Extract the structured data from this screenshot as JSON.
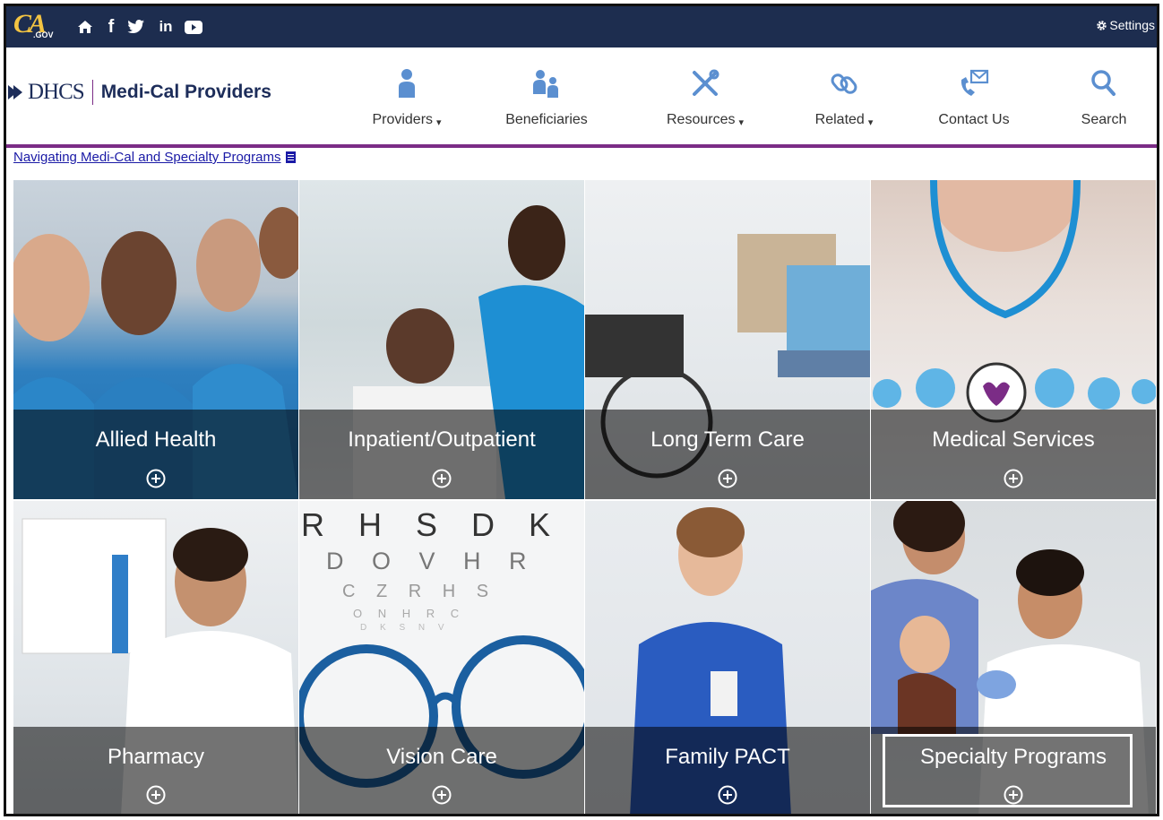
{
  "topbar": {
    "logo_text": "CA",
    "logo_sub": ".GOV",
    "social_icons": [
      "home-icon",
      "facebook-icon",
      "twitter-icon",
      "linkedin-icon",
      "youtube-icon"
    ],
    "settings_label": "Settings"
  },
  "header": {
    "org": "DHCS",
    "site_title": "Medi-Cal Providers",
    "nav": [
      {
        "label": "Providers",
        "icon": "person-icon",
        "dropdown": true
      },
      {
        "label": "Beneficiaries",
        "icon": "people-icon",
        "dropdown": false
      },
      {
        "label": "Resources",
        "icon": "tools-icon",
        "dropdown": true
      },
      {
        "label": "Related",
        "icon": "link-icon",
        "dropdown": true
      },
      {
        "label": "Contact Us",
        "icon": "phone-mail-icon",
        "dropdown": false
      },
      {
        "label": "Search",
        "icon": "search-icon",
        "dropdown": false
      }
    ]
  },
  "nav_link": "Navigating Medi-Cal and Specialty Programs",
  "tiles": [
    {
      "label": "Allied Health"
    },
    {
      "label": "Inpatient/Outpatient"
    },
    {
      "label": "Long Term Care"
    },
    {
      "label": "Medical Services"
    },
    {
      "label": "Pharmacy"
    },
    {
      "label": "Vision Care"
    },
    {
      "label": "Family PACT"
    },
    {
      "label": "Specialty Programs"
    }
  ],
  "colors": {
    "topbar": "#1d2d4f",
    "accent": "#7b2c86",
    "brand": "#1d2d5a",
    "icon_blue": "#5b8fd0"
  },
  "eye_chart": {
    "row1": "R H S D K",
    "row2": "D O V H R",
    "row3": "C Z R H S",
    "row4": "O N H R C",
    "row5": "D K S N V"
  }
}
